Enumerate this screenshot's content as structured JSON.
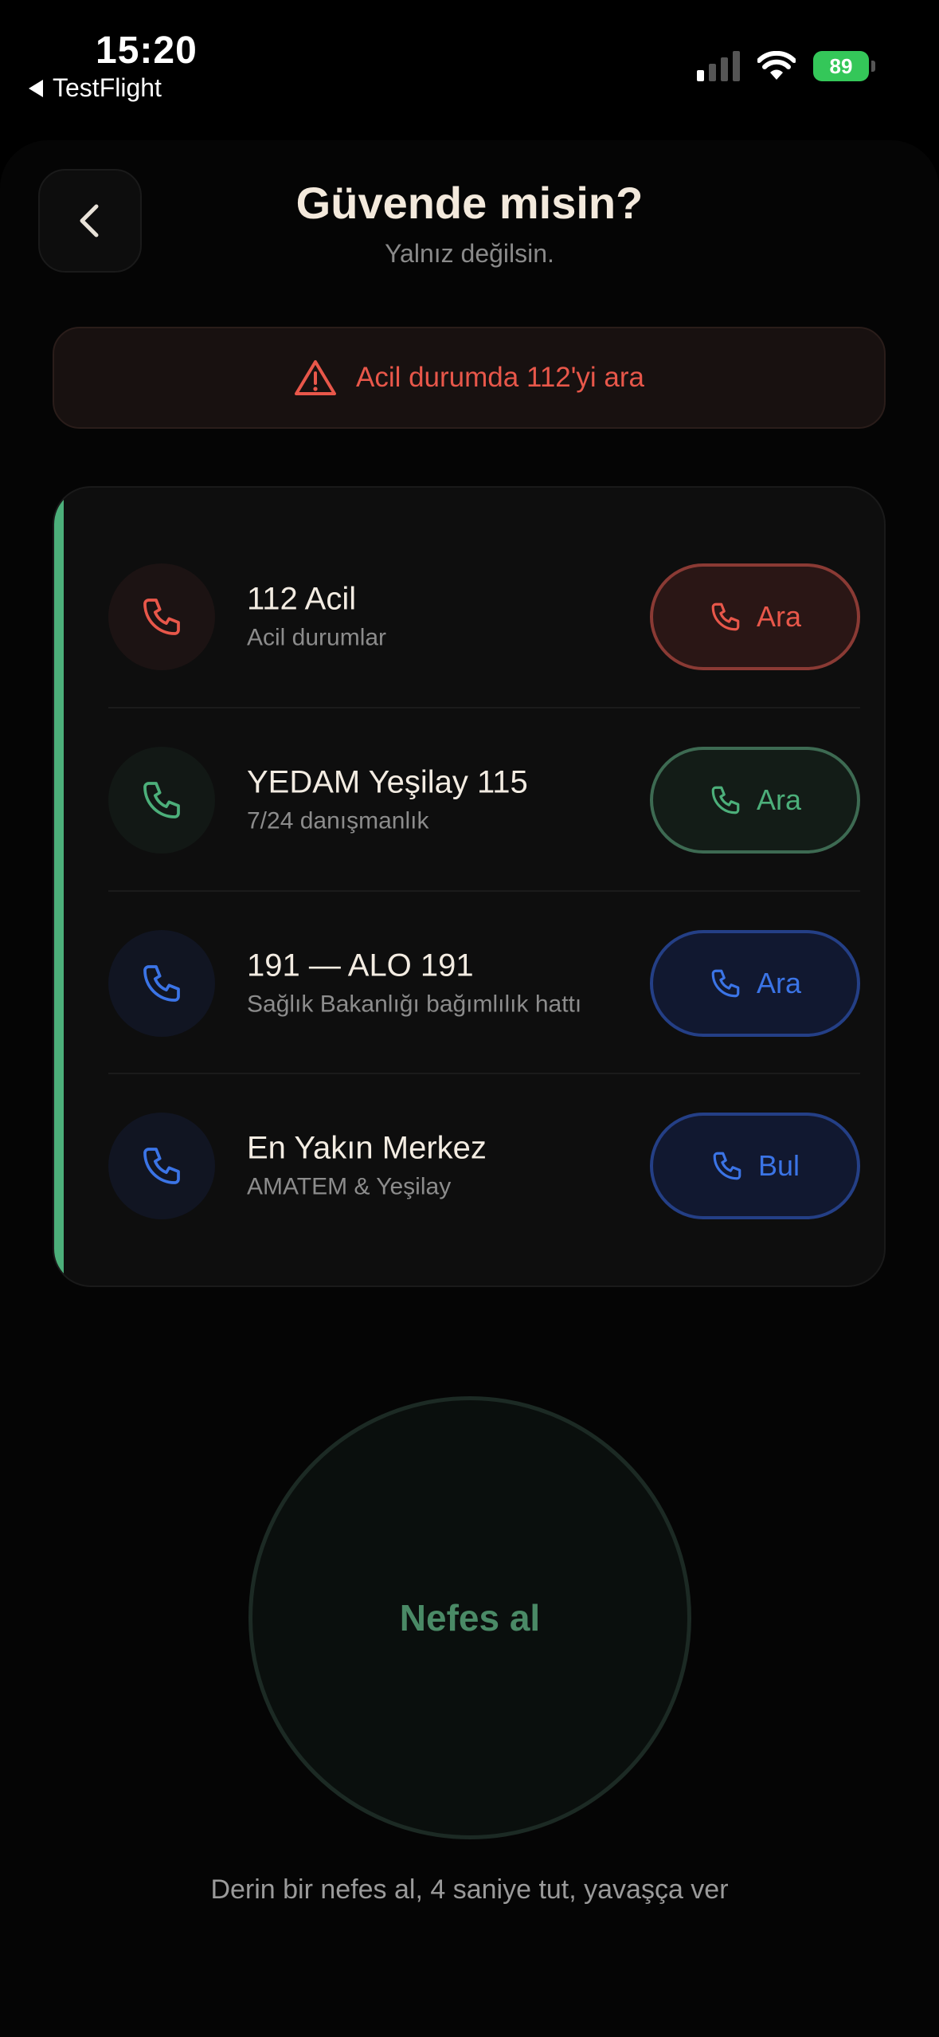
{
  "status_bar": {
    "time": "15:20",
    "back_app": "TestFlight",
    "battery": "89"
  },
  "header": {
    "title": "Güvende misin?",
    "subtitle": "Yalnız değilsin."
  },
  "alert": {
    "text": "Acil durumda 112'yi ara",
    "icon": "warning-icon"
  },
  "hotlines": [
    {
      "title": "112 Acil",
      "subtitle": "Acil durumlar",
      "button": "Ara",
      "color": "#e8574a"
    },
    {
      "title": "YEDAM Yeşilay 115",
      "subtitle": "7/24 danışmanlık",
      "button": "Ara",
      "color": "#4caf7a"
    },
    {
      "title": "191 — ALO 191",
      "subtitle": "Sağlık Bakanlığı bağımlılık hattı",
      "button": "Ara",
      "color": "#3b74e6"
    },
    {
      "title": "En Yakın Merkez",
      "subtitle": "AMATEM & Yeşilay",
      "button": "Bul",
      "color": "#3b74e6"
    }
  ],
  "breathing": {
    "label": "Nefes al",
    "hint": "Derin bir nefes al, 4 saniye tut, yavaşça ver"
  },
  "colors": {
    "accent_green": "#4caf7a",
    "emergency_red": "#e8574a",
    "info_blue": "#3b74e6",
    "title_cream": "#f3e9dc"
  }
}
